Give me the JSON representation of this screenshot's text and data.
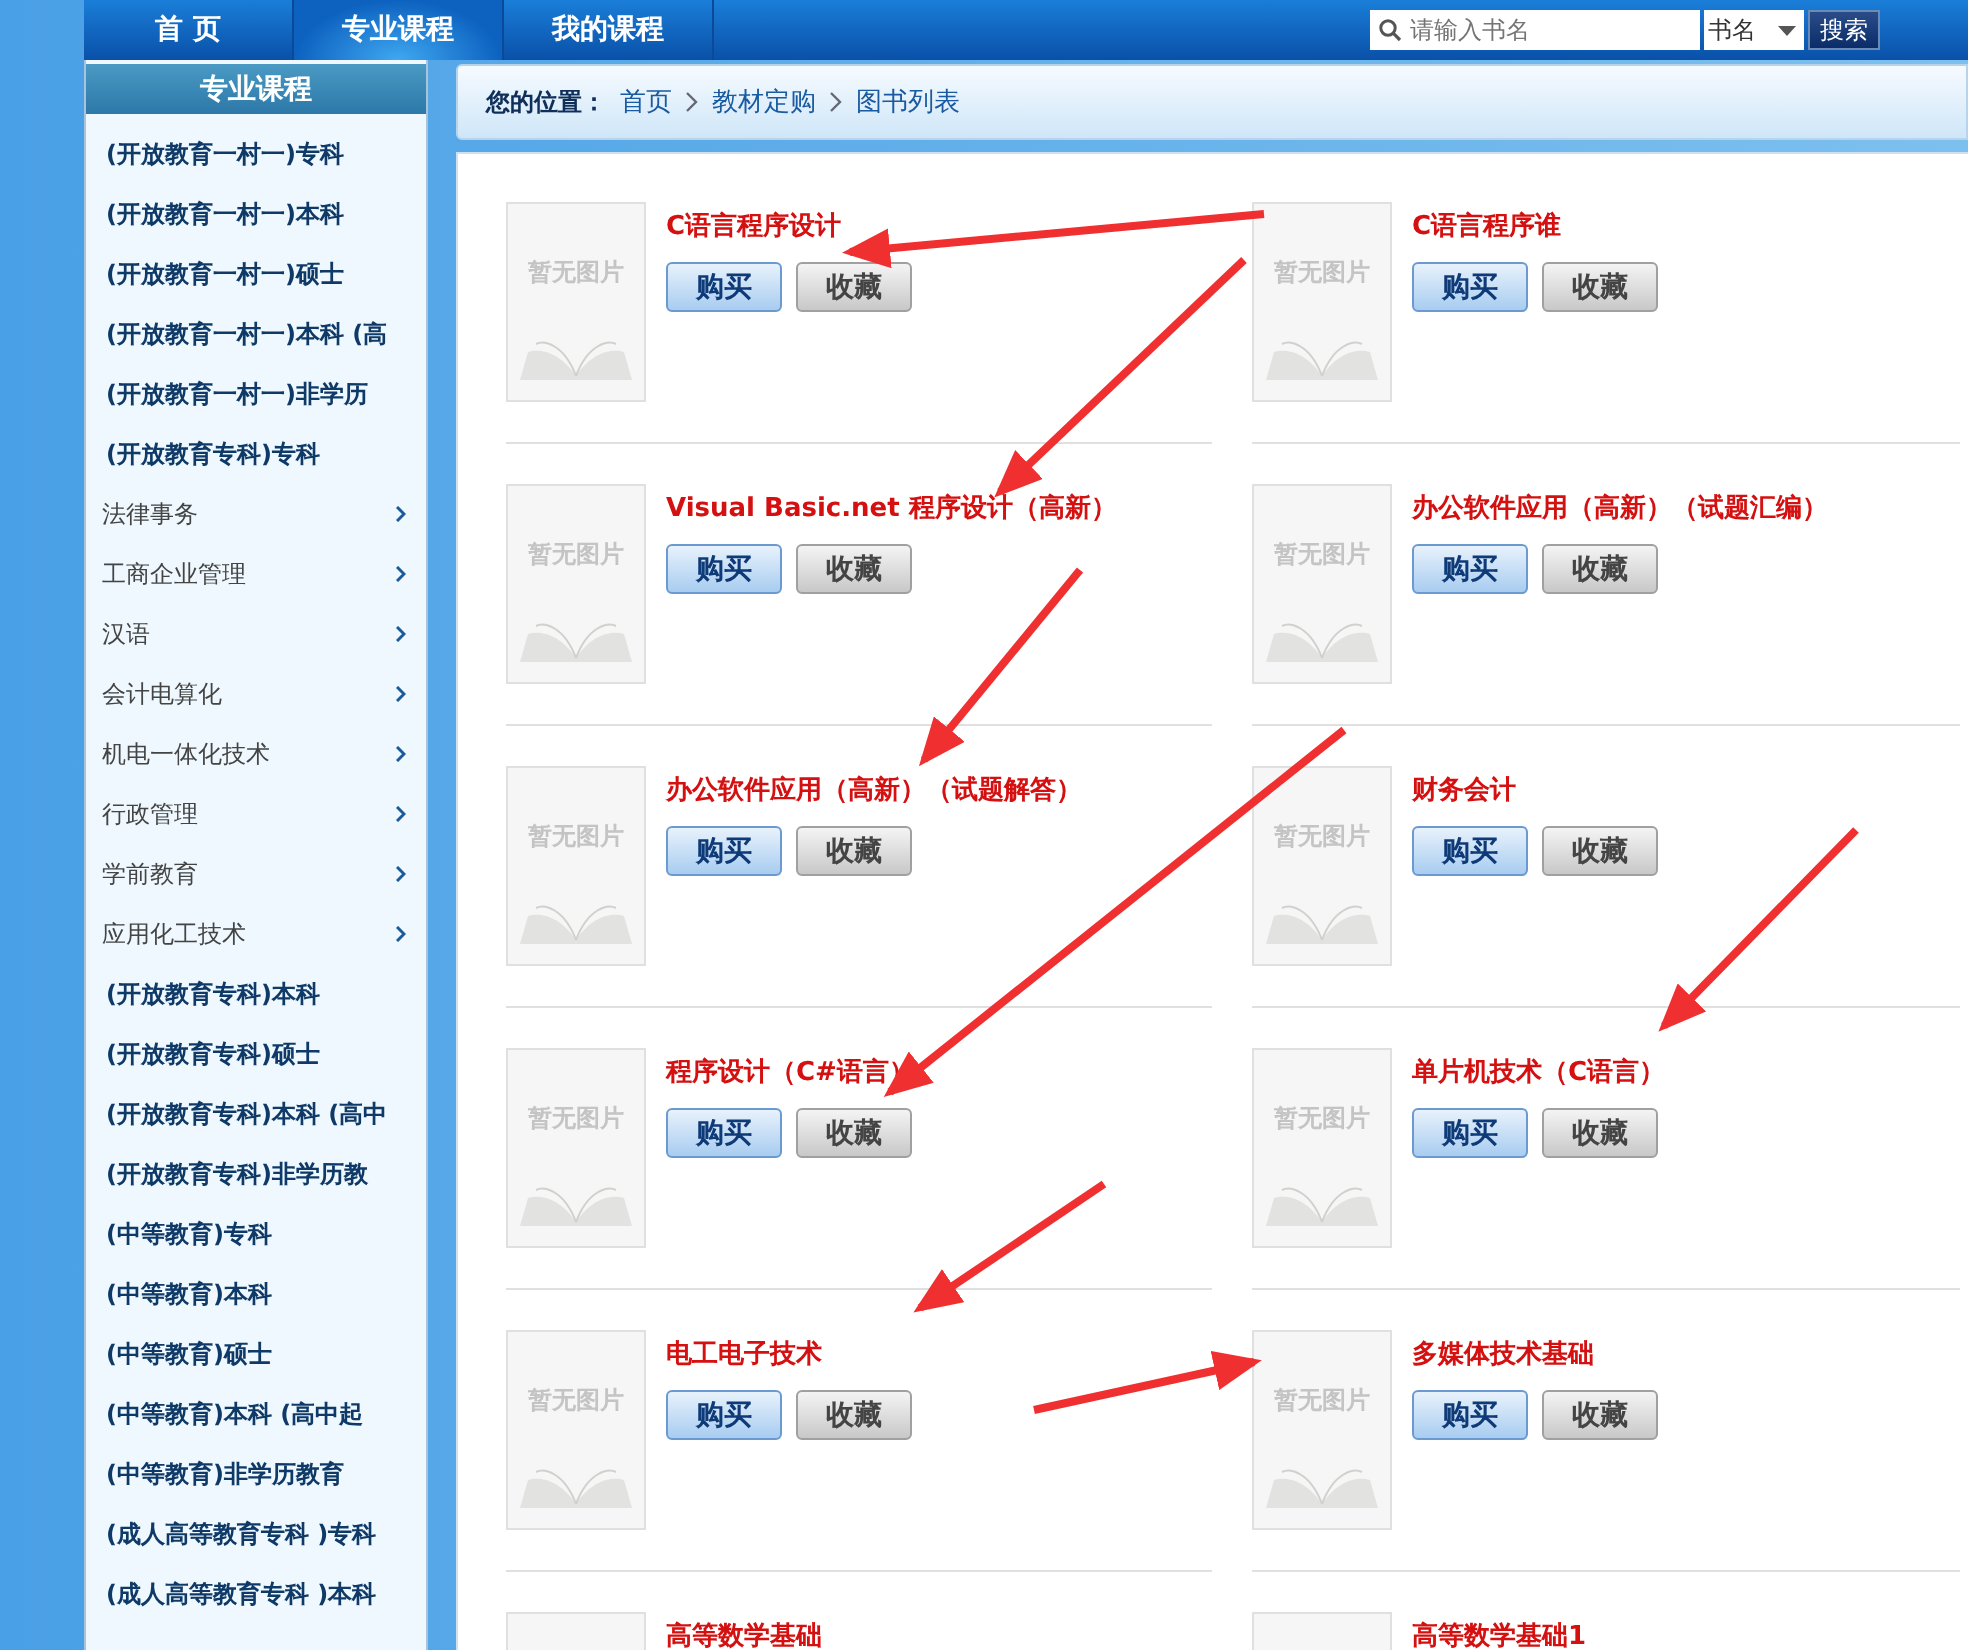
{
  "nav": {
    "tabs": [
      {
        "label": "首 页",
        "selected": false
      },
      {
        "label": "专业课程",
        "selected": true
      },
      {
        "label": "我的课程",
        "selected": false
      }
    ],
    "search": {
      "placeholder": "请输入书名",
      "field": "书名",
      "button": "搜索"
    }
  },
  "sidebar": {
    "title": "专业课程",
    "items": [
      {
        "label": "(开放教育一村一)专科",
        "kind": "program"
      },
      {
        "label": "(开放教育一村一)本科",
        "kind": "program"
      },
      {
        "label": "(开放教育一村一)硕士",
        "kind": "program"
      },
      {
        "label": "(开放教育一村一)本科 (高",
        "kind": "program"
      },
      {
        "label": "(开放教育一村一)非学历",
        "kind": "program"
      },
      {
        "label": "(开放教育专科)专科",
        "kind": "program"
      },
      {
        "label": "法律事务",
        "kind": "category"
      },
      {
        "label": "工商企业管理",
        "kind": "category"
      },
      {
        "label": "汉语",
        "kind": "category"
      },
      {
        "label": "会计电算化",
        "kind": "category"
      },
      {
        "label": "机电一体化技术",
        "kind": "category"
      },
      {
        "label": "行政管理",
        "kind": "category"
      },
      {
        "label": "学前教育",
        "kind": "category"
      },
      {
        "label": "应用化工技术",
        "kind": "category"
      },
      {
        "label": "(开放教育专科)本科",
        "kind": "program"
      },
      {
        "label": "(开放教育专科)硕士",
        "kind": "program"
      },
      {
        "label": "(开放教育专科)本科 (高中",
        "kind": "program"
      },
      {
        "label": "(开放教育专科)非学历教",
        "kind": "program"
      },
      {
        "label": "(中等教育)专科",
        "kind": "program"
      },
      {
        "label": "(中等教育)本科",
        "kind": "program"
      },
      {
        "label": "(中等教育)硕士",
        "kind": "program"
      },
      {
        "label": "(中等教育)本科 (高中起",
        "kind": "program"
      },
      {
        "label": "(中等教育)非学历教育",
        "kind": "program"
      },
      {
        "label": "(成人高等教育专科  )专科",
        "kind": "program"
      },
      {
        "label": "(成人高等教育专科  )本科",
        "kind": "program"
      }
    ]
  },
  "breadcrumb": {
    "label": "您的位置：",
    "items": [
      "首页",
      "教材定购",
      "图书列表"
    ]
  },
  "books": [
    {
      "title": "C语言程序设计",
      "cover": "暂无图片",
      "buy": "购买",
      "favorite": "收藏"
    },
    {
      "title": "C语言程序谁",
      "cover": "暂无图片",
      "buy": "购买",
      "favorite": "收藏"
    },
    {
      "title": "Visual Basic.net 程序设计（高新）",
      "cover": "暂无图片",
      "buy": "购买",
      "favorite": "收藏"
    },
    {
      "title": "办公软件应用（高新）（试题汇编）",
      "cover": "暂无图片",
      "buy": "购买",
      "favorite": "收藏"
    },
    {
      "title": "办公软件应用（高新）（试题解答）",
      "cover": "暂无图片",
      "buy": "购买",
      "favorite": "收藏"
    },
    {
      "title": "财务会计",
      "cover": "暂无图片",
      "buy": "购买",
      "favorite": "收藏"
    },
    {
      "title": "程序设计（C#语言）",
      "cover": "暂无图片",
      "buy": "购买",
      "favorite": "收藏"
    },
    {
      "title": "单片机技术（C语言）",
      "cover": "暂无图片",
      "buy": "购买",
      "favorite": "收藏"
    },
    {
      "title": "电工电子技术",
      "cover": "暂无图片",
      "buy": "购买",
      "favorite": "收藏"
    },
    {
      "title": "多媒体技术基础",
      "cover": "暂无图片",
      "buy": "购买",
      "favorite": "收藏"
    },
    {
      "title": "高等数学基础"
    },
    {
      "title": "高等数学基础1"
    }
  ]
}
